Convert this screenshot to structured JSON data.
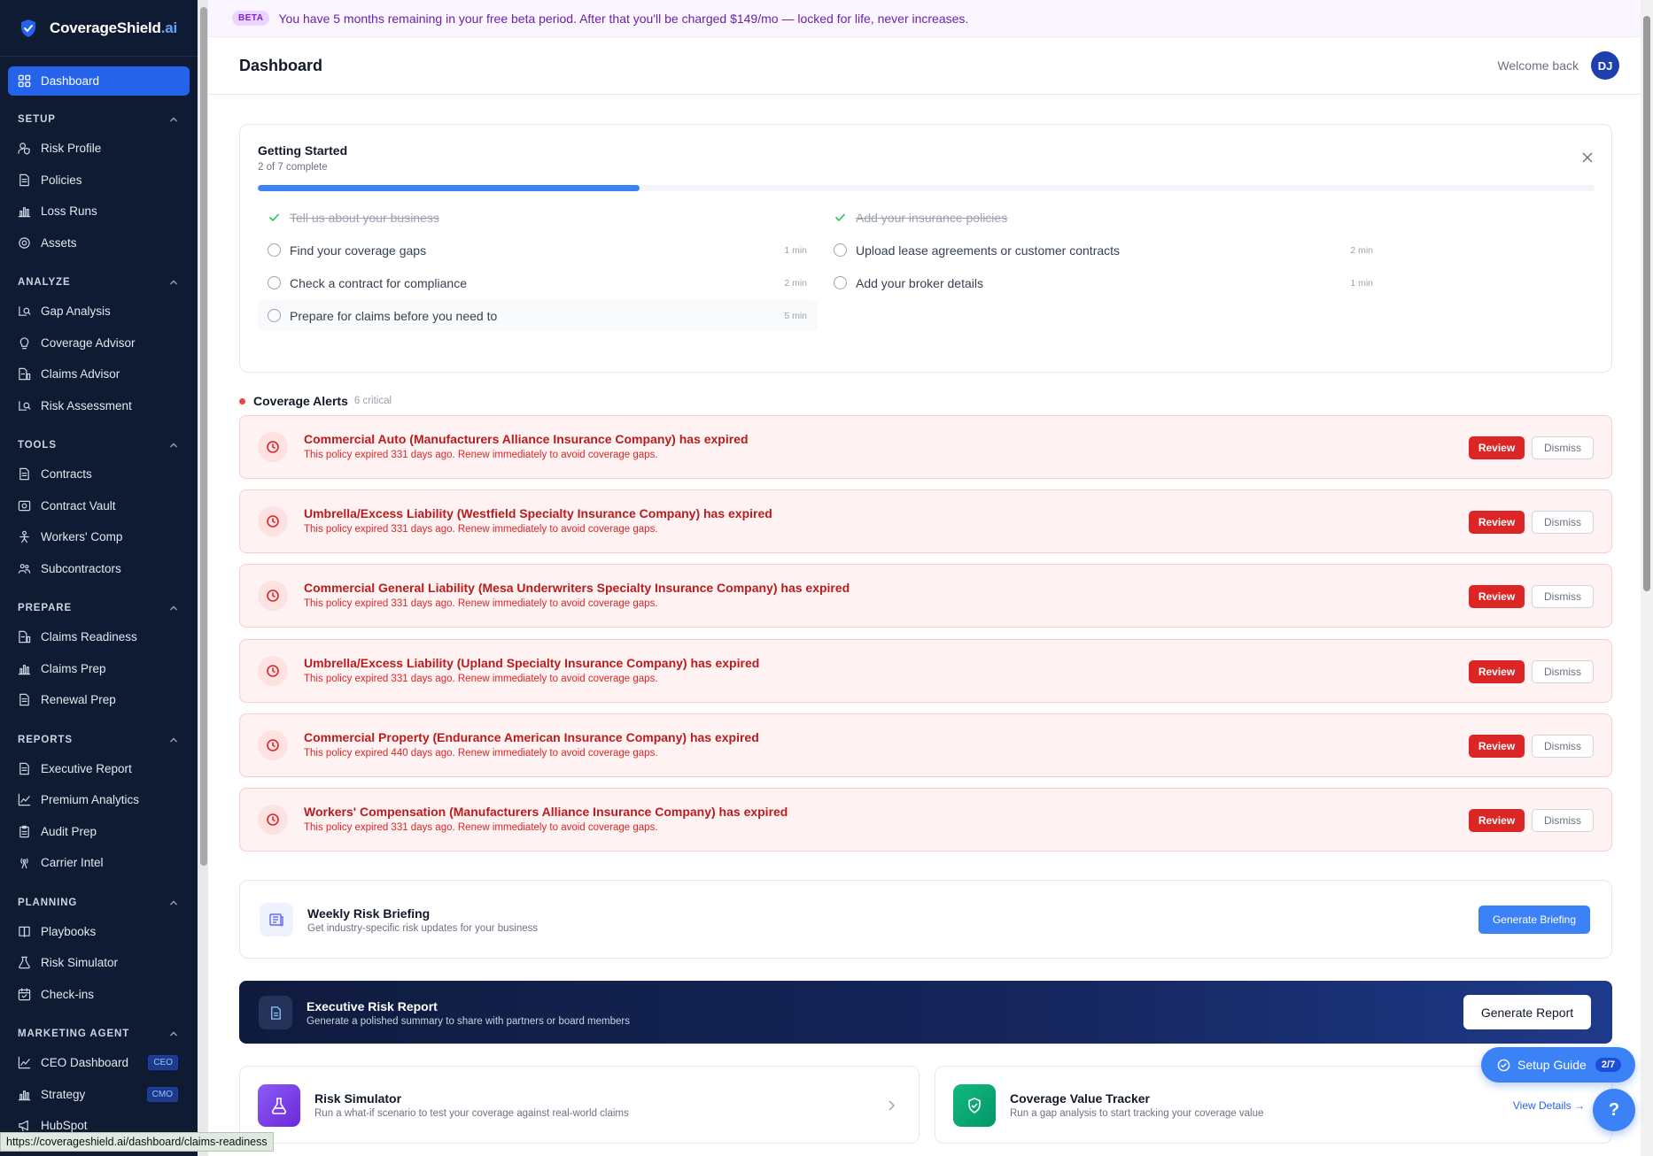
{
  "brand": {
    "name": "CoverageShield",
    "suffix": ".ai"
  },
  "sidebar": {
    "active": "Dashboard",
    "sections": [
      {
        "title": "SETUP",
        "items": [
          {
            "label": "Risk Profile",
            "icon": "user-shield-icon"
          },
          {
            "label": "Policies",
            "icon": "document-icon"
          },
          {
            "label": "Loss Runs",
            "icon": "bar-chart-icon"
          },
          {
            "label": "Assets",
            "icon": "gear-icon"
          }
        ]
      },
      {
        "title": "ANALYZE",
        "items": [
          {
            "label": "Gap Analysis",
            "icon": "chart-search-icon"
          },
          {
            "label": "Coverage Advisor",
            "icon": "lightbulb-icon"
          },
          {
            "label": "Claims Advisor",
            "icon": "file-chart-icon"
          },
          {
            "label": "Risk Assessment",
            "icon": "chart-search-icon"
          }
        ]
      },
      {
        "title": "TOOLS",
        "items": [
          {
            "label": "Contracts",
            "icon": "document-icon"
          },
          {
            "label": "Contract Vault",
            "icon": "vault-icon"
          },
          {
            "label": "Workers' Comp",
            "icon": "person-icon"
          },
          {
            "label": "Subcontractors",
            "icon": "people-icon"
          }
        ]
      },
      {
        "title": "PREPARE",
        "items": [
          {
            "label": "Claims Readiness",
            "icon": "file-chart-icon"
          },
          {
            "label": "Claims Prep",
            "icon": "bar-chart-icon"
          },
          {
            "label": "Renewal Prep",
            "icon": "document-icon"
          }
        ]
      },
      {
        "title": "REPORTS",
        "items": [
          {
            "label": "Executive Report",
            "icon": "document-icon"
          },
          {
            "label": "Premium Analytics",
            "icon": "line-chart-icon"
          },
          {
            "label": "Audit Prep",
            "icon": "clipboard-icon"
          },
          {
            "label": "Carrier Intel",
            "icon": "signal-icon"
          }
        ]
      },
      {
        "title": "PLANNING",
        "items": [
          {
            "label": "Playbooks",
            "icon": "book-icon"
          },
          {
            "label": "Risk Simulator",
            "icon": "flask-icon"
          },
          {
            "label": "Check-ins",
            "icon": "calendar-icon"
          }
        ]
      },
      {
        "title": "MARKETING AGENT",
        "items": [
          {
            "label": "CEO Dashboard",
            "icon": "line-chart-icon",
            "tag": "CEO"
          },
          {
            "label": "Strategy",
            "icon": "bar-chart-icon",
            "tag": "CMO"
          },
          {
            "label": "HubSpot",
            "icon": "megaphone-icon"
          }
        ]
      }
    ]
  },
  "beta": {
    "pill": "BETA",
    "message": "You have 5 months remaining in your free beta period. After that you'll be charged $149/mo — locked for life, never increases."
  },
  "header": {
    "title": "Dashboard",
    "welcome": "Welcome back",
    "avatar": "DJ"
  },
  "getting_started": {
    "title": "Getting Started",
    "subtitle": "2 of 7 complete",
    "progress": 0.2857,
    "tasks_left": [
      {
        "label": "Tell us about your business",
        "done": true,
        "time": ""
      },
      {
        "label": "Find your coverage gaps",
        "done": false,
        "time": "1 min"
      },
      {
        "label": "Check a contract for compliance",
        "done": false,
        "time": "2 min"
      },
      {
        "label": "Prepare for claims before you need to",
        "done": false,
        "time": "5 min"
      }
    ],
    "tasks_right": [
      {
        "label": "Add your insurance policies",
        "done": true,
        "time": ""
      },
      {
        "label": "Upload lease agreements or customer contracts",
        "done": false,
        "time": "2 min"
      },
      {
        "label": "Add your broker details",
        "done": false,
        "time": "1 min"
      }
    ]
  },
  "alerts": {
    "title": "Coverage Alerts",
    "count": "6 critical",
    "review_label": "Review",
    "dismiss_label": "Dismiss",
    "items": [
      {
        "title": "Commercial Auto (Manufacturers Alliance Insurance Company) has expired",
        "desc": "This policy expired 331 days ago. Renew immediately to avoid coverage gaps."
      },
      {
        "title": "Umbrella/Excess Liability (Westfield Specialty Insurance Company) has expired",
        "desc": "This policy expired 331 days ago. Renew immediately to avoid coverage gaps."
      },
      {
        "title": "Commercial General Liability (Mesa Underwriters Specialty Insurance Company) has expired",
        "desc": "This policy expired 331 days ago. Renew immediately to avoid coverage gaps."
      },
      {
        "title": "Umbrella/Excess Liability (Upland Specialty Insurance Company) has expired",
        "desc": "This policy expired 331 days ago. Renew immediately to avoid coverage gaps."
      },
      {
        "title": "Commercial Property (Endurance American Insurance Company) has expired",
        "desc": "This policy expired 440 days ago. Renew immediately to avoid coverage gaps."
      },
      {
        "title": "Workers' Compensation (Manufacturers Alliance Insurance Company) has expired",
        "desc": "This policy expired 331 days ago. Renew immediately to avoid coverage gaps."
      }
    ]
  },
  "weekly_briefing": {
    "title": "Weekly Risk Briefing",
    "desc": "Get industry-specific risk updates for your business",
    "button": "Generate Briefing"
  },
  "executive_report": {
    "title": "Executive Risk Report",
    "desc": "Generate a polished summary to share with partners or board members",
    "button": "Generate Report"
  },
  "risk_simulator": {
    "title": "Risk Simulator",
    "desc": "Run a what-if scenario to test your coverage against real-world claims"
  },
  "coverage_value": {
    "title": "Coverage Value Tracker",
    "desc": "Run a gap analysis to start tracking your coverage value",
    "link": "View Details →"
  },
  "setup_guide": {
    "label": "Setup Guide",
    "progress": "2/7"
  },
  "help": {
    "label": "?"
  },
  "status_url": "https://coverageshield.ai/dashboard/claims-readiness",
  "colors": {
    "sidebar_bg": "#0f1b33",
    "accent": "#3b82f6",
    "danger": "#dc2626",
    "beta_text": "#6b21a8"
  }
}
